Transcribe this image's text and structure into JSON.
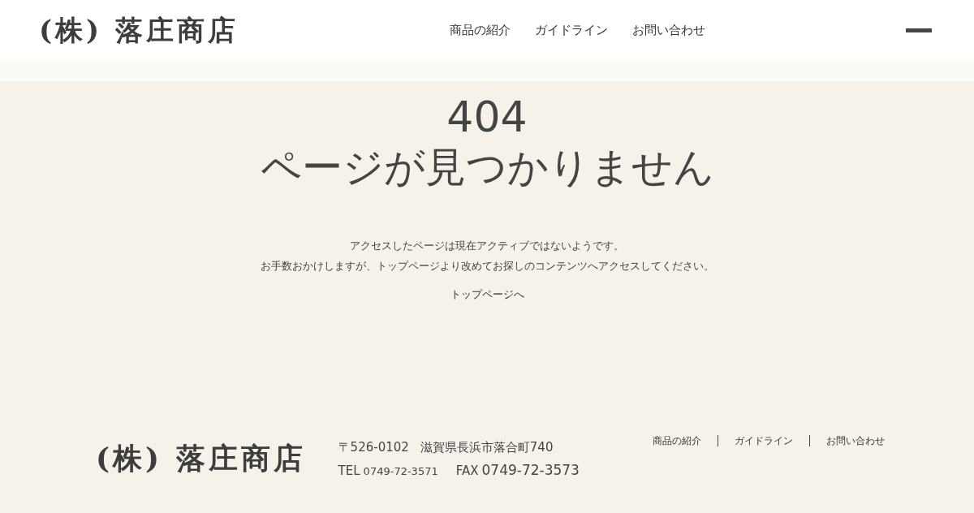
{
  "header": {
    "logo": "(株) 落庄商店",
    "nav": [
      "商品の紹介",
      "ガイドライン",
      "お問い合わせ"
    ]
  },
  "error": {
    "code": "404",
    "title": "ページが見つかりません",
    "message": [
      "アクセスしたページは現在アクティブではないようです。",
      "お手数おかけしますが、トップページより改めてお探しのコンテンツへアクセスしてください。"
    ],
    "link": "トップページへ"
  },
  "footer": {
    "logo": "(株) 落庄商店",
    "postal": "〒526-0102",
    "address": "滋賀県長浜市落合町740",
    "tel_label": "TEL",
    "tel": "0749-72-3571",
    "fax_label": "FAX",
    "fax": "0749-72-3573",
    "nav": [
      "商品の紹介",
      "ガイドライン",
      "お問い合わせ"
    ]
  }
}
